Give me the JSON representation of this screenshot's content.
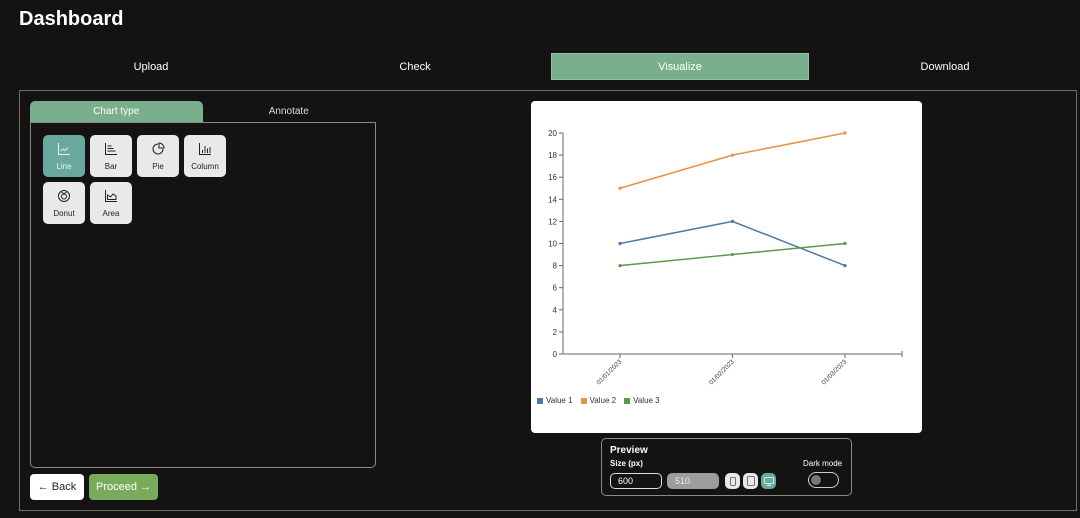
{
  "header": {
    "title": "Dashboard"
  },
  "steps": [
    {
      "label": "Upload",
      "active": false
    },
    {
      "label": "Check",
      "active": false
    },
    {
      "label": "Visualize",
      "active": true
    },
    {
      "label": "Download",
      "active": false
    }
  ],
  "sub_tabs": [
    {
      "label": "Chart type",
      "active": true
    },
    {
      "label": "Annotate",
      "active": false
    }
  ],
  "chart_types": [
    {
      "label": "Line",
      "icon": "line-chart-icon",
      "active": true
    },
    {
      "label": "Bar",
      "icon": "bar-chart-icon",
      "active": false
    },
    {
      "label": "Pie",
      "icon": "pie-chart-icon",
      "active": false
    },
    {
      "label": "Column",
      "icon": "column-chart-icon",
      "active": false
    },
    {
      "label": "Donut",
      "icon": "donut-chart-icon",
      "active": false
    },
    {
      "label": "Area",
      "icon": "area-chart-icon",
      "active": false
    }
  ],
  "nav": {
    "back_label": "← Back",
    "proceed_label": "Proceed →"
  },
  "preview": {
    "title": "Preview",
    "size_label": "Size (px)",
    "width_value": "600",
    "height_value": "510",
    "dark_mode_label": "Dark mode",
    "dark_mode_on": false,
    "devices": [
      "mobile-icon",
      "tablet-icon",
      "desktop-icon"
    ],
    "active_device": "desktop-icon"
  },
  "colors": {
    "accent": "#7aaf8e",
    "proceed": "#79ab5c",
    "active_type": "#6aa9a0"
  },
  "chart_data": {
    "type": "line",
    "categories": [
      "01/01/2023",
      "01/02/2023",
      "01/03/2023"
    ],
    "series": [
      {
        "name": "Value 1",
        "color": "#4e79a7",
        "values": [
          10,
          12,
          8
        ]
      },
      {
        "name": "Value 2",
        "color": "#e49444",
        "values": [
          15,
          18,
          20
        ]
      },
      {
        "name": "Value 3",
        "color": "#5b9a48",
        "values": [
          8,
          9,
          10
        ]
      }
    ],
    "yticks": [
      0,
      2,
      4,
      6,
      8,
      10,
      12,
      14,
      16,
      18,
      20
    ],
    "ylim": [
      0,
      20
    ],
    "title": "",
    "xlabel": "",
    "ylabel": "",
    "grid": false,
    "legend": "bottom-left"
  }
}
